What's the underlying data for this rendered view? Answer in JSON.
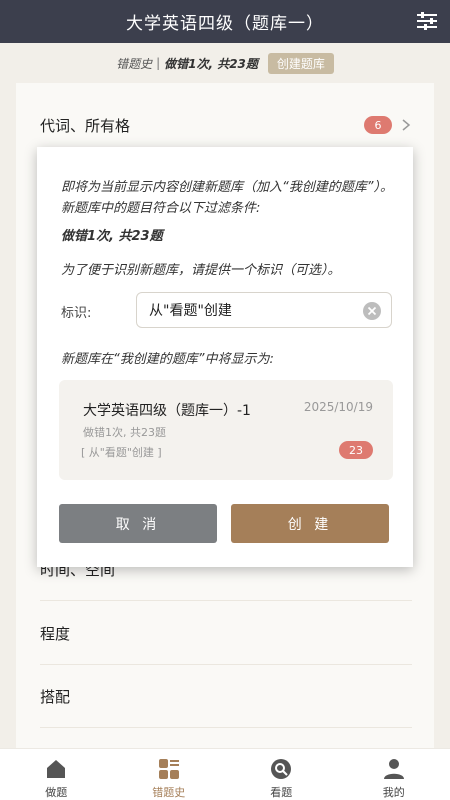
{
  "header": {
    "title": "大学英语四级（题库一）",
    "filter_icon": "filter-sliders-icon"
  },
  "substrip": {
    "label": "错题史",
    "separator": "|",
    "condition": "做错1次, 共23题",
    "create_label": "创建题库"
  },
  "list": {
    "items": [
      {
        "label": "代词、所有格",
        "count": "6"
      },
      {
        "label": "时间、空间"
      },
      {
        "label": "程度"
      },
      {
        "label": "搭配"
      }
    ]
  },
  "dialog": {
    "intro": "即将为当前显示内容创建新题库（加入“我创建的题库”）。新题库中的题目符合以下过滤条件:",
    "condition": "做错1次, 共23题",
    "prompt": "为了便于识别新题库，请提供一个标识（可选）。",
    "id_label": "标识:",
    "id_value": "从\"看题\"创建",
    "preview_intro": "新题库在“我创建的题库”中将显示为:",
    "preview": {
      "title": "大学英语四级（题库一）-1",
      "date": "2025/10/19",
      "condition": "做错1次, 共23题",
      "tag": "[ 从\"看题\"创建 ]",
      "count": "23"
    },
    "cancel_label": "取 消",
    "create_label": "创 建"
  },
  "tabbar": {
    "tabs": [
      {
        "label": "做题",
        "icon": "home-icon"
      },
      {
        "label": "错题史",
        "icon": "grid-list-icon",
        "active": true
      },
      {
        "label": "看题",
        "icon": "search-bubble-icon"
      },
      {
        "label": "我的",
        "icon": "person-icon"
      }
    ]
  },
  "colors": {
    "topbar": "#3c3f4d",
    "badge": "#de7a70",
    "accent": "#a57f59",
    "cancel": "#7c7f82",
    "create_tag": "#c8bba2"
  }
}
